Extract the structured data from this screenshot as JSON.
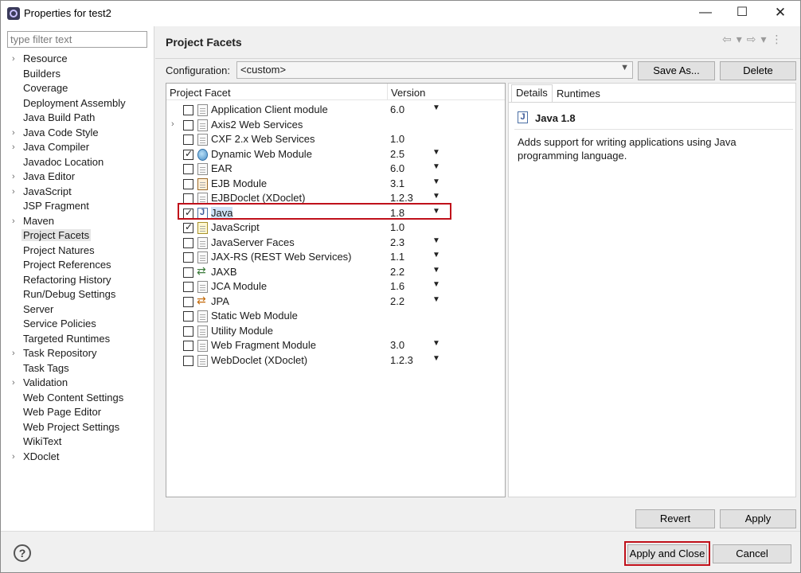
{
  "window": {
    "title": "Properties for test2",
    "controls": {
      "minimize": "—",
      "maximize": "☐",
      "close": "✕"
    }
  },
  "filter": {
    "placeholder": "type filter text",
    "value": ""
  },
  "tree": {
    "items": [
      {
        "label": "Resource",
        "expandable": true
      },
      {
        "label": "Builders",
        "expandable": false
      },
      {
        "label": "Coverage",
        "expandable": false
      },
      {
        "label": "Deployment Assembly",
        "expandable": false
      },
      {
        "label": "Java Build Path",
        "expandable": false
      },
      {
        "label": "Java Code Style",
        "expandable": true
      },
      {
        "label": "Java Compiler",
        "expandable": true
      },
      {
        "label": "Javadoc Location",
        "expandable": false
      },
      {
        "label": "Java Editor",
        "expandable": true
      },
      {
        "label": "JavaScript",
        "expandable": true
      },
      {
        "label": "JSP Fragment",
        "expandable": false
      },
      {
        "label": "Maven",
        "expandable": true
      },
      {
        "label": "Project Facets",
        "expandable": false,
        "selected": true
      },
      {
        "label": "Project Natures",
        "expandable": false
      },
      {
        "label": "Project References",
        "expandable": false
      },
      {
        "label": "Refactoring History",
        "expandable": false
      },
      {
        "label": "Run/Debug Settings",
        "expandable": false
      },
      {
        "label": "Server",
        "expandable": false
      },
      {
        "label": "Service Policies",
        "expandable": false
      },
      {
        "label": "Targeted Runtimes",
        "expandable": false
      },
      {
        "label": "Task Repository",
        "expandable": true
      },
      {
        "label": "Task Tags",
        "expandable": false
      },
      {
        "label": "Validation",
        "expandable": true
      },
      {
        "label": "Web Content Settings",
        "expandable": false
      },
      {
        "label": "Web Page Editor",
        "expandable": false
      },
      {
        "label": "Web Project Settings",
        "expandable": false
      },
      {
        "label": "WikiText",
        "expandable": false
      },
      {
        "label": "XDoclet",
        "expandable": true
      }
    ]
  },
  "page": {
    "title": "Project Facets",
    "nav": [
      "⇦",
      "▾",
      "⇨",
      "▾",
      "⋮"
    ]
  },
  "config": {
    "label": "Configuration:",
    "value": "<custom>",
    "save_as": "Save As...",
    "delete": "Delete"
  },
  "facets": {
    "col_facet": "Project Facet",
    "col_version": "Version",
    "rows": [
      {
        "name": "Application Client module",
        "version": "6.0",
        "checked": false,
        "dropdown": true,
        "icon": "doc"
      },
      {
        "name": "Axis2 Web Services",
        "version": "",
        "checked": false,
        "dropdown": false,
        "icon": "doc",
        "expandable": true
      },
      {
        "name": "CXF 2.x Web Services",
        "version": "1.0",
        "checked": false,
        "dropdown": false,
        "icon": "doc"
      },
      {
        "name": "Dynamic Web Module",
        "version": "2.5",
        "checked": true,
        "dropdown": true,
        "icon": "globe"
      },
      {
        "name": "EAR",
        "version": "6.0",
        "checked": false,
        "dropdown": true,
        "icon": "doc"
      },
      {
        "name": "EJB Module",
        "version": "3.1",
        "checked": false,
        "dropdown": true,
        "icon": "ejb"
      },
      {
        "name": "EJBDoclet (XDoclet)",
        "version": "1.2.3",
        "checked": false,
        "dropdown": true,
        "icon": "doc"
      },
      {
        "name": "Java",
        "version": "1.8",
        "checked": true,
        "dropdown": true,
        "icon": "java",
        "highlighted": true
      },
      {
        "name": "JavaScript",
        "version": "1.0",
        "checked": true,
        "dropdown": false,
        "icon": "js"
      },
      {
        "name": "JavaServer Faces",
        "version": "2.3",
        "checked": false,
        "dropdown": true,
        "icon": "doc"
      },
      {
        "name": "JAX-RS (REST Web Services)",
        "version": "1.1",
        "checked": false,
        "dropdown": true,
        "icon": "doc"
      },
      {
        "name": "JAXB",
        "version": "2.2",
        "checked": false,
        "dropdown": true,
        "icon": "jaxb"
      },
      {
        "name": "JCA Module",
        "version": "1.6",
        "checked": false,
        "dropdown": true,
        "icon": "doc"
      },
      {
        "name": "JPA",
        "version": "2.2",
        "checked": false,
        "dropdown": true,
        "icon": "jpa"
      },
      {
        "name": "Static Web Module",
        "version": "",
        "checked": false,
        "dropdown": false,
        "icon": "doc"
      },
      {
        "name": "Utility Module",
        "version": "",
        "checked": false,
        "dropdown": false,
        "icon": "doc"
      },
      {
        "name": "Web Fragment Module",
        "version": "3.0",
        "checked": false,
        "dropdown": true,
        "icon": "doc"
      },
      {
        "name": "WebDoclet (XDoclet)",
        "version": "1.2.3",
        "checked": false,
        "dropdown": true,
        "icon": "doc"
      }
    ]
  },
  "details": {
    "tab_details": "Details",
    "tab_runtimes": "Runtimes",
    "title": "Java 1.8",
    "description": "Adds support for writing applications using Java programming language."
  },
  "buttons": {
    "revert": "Revert",
    "apply": "Apply",
    "apply_and_close": "Apply and Close",
    "cancel": "Cancel",
    "help": "?"
  },
  "colors": {
    "highlight_border": "#c0101a",
    "selection": "#cfe3f7"
  }
}
